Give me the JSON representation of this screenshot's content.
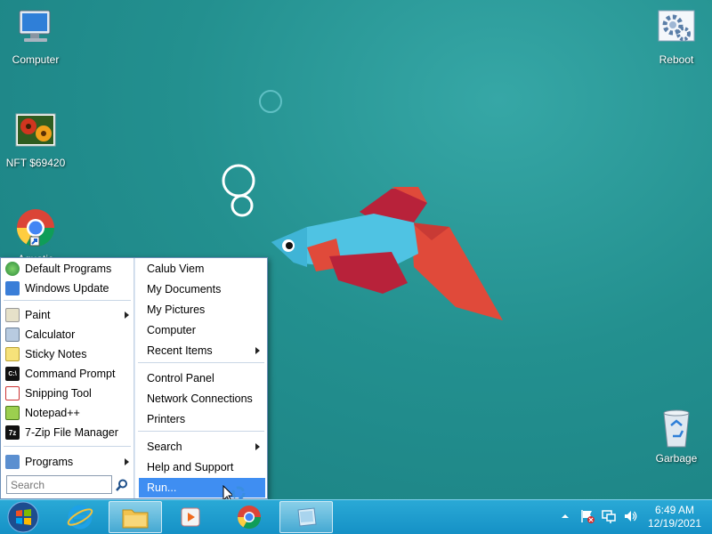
{
  "desktop": {
    "icons": [
      {
        "label": "Computer",
        "icon": "computer-icon"
      },
      {
        "label": "NFT $69420",
        "icon": "flower-image-icon"
      },
      {
        "label": "Aquatic",
        "icon": "chrome-icon"
      },
      {
        "label": "Reboot",
        "icon": "reboot-icon"
      },
      {
        "label": "Garbage",
        "icon": "recycle-bin-icon"
      }
    ]
  },
  "start_menu": {
    "left_items": [
      {
        "label": "Default Programs",
        "icon": "default-programs-icon"
      },
      {
        "label": "Windows Update",
        "icon": "windows-update-icon"
      },
      {
        "label": "Paint",
        "icon": "paint-icon",
        "submenu": true
      },
      {
        "label": "Calculator",
        "icon": "calculator-icon"
      },
      {
        "label": "Sticky Notes",
        "icon": "sticky-notes-icon"
      },
      {
        "label": "Command Prompt",
        "icon": "command-prompt-icon"
      },
      {
        "label": "Snipping Tool",
        "icon": "snipping-tool-icon"
      },
      {
        "label": "Notepad++",
        "icon": "notepad-icon"
      },
      {
        "label": "7-Zip File Manager",
        "icon": "7zip-icon"
      },
      {
        "label": "Programs",
        "icon": "programs-icon",
        "submenu": true
      }
    ],
    "search_placeholder": "Search",
    "right_items": [
      {
        "label": "Calub Viem"
      },
      {
        "label": "My Documents"
      },
      {
        "label": "My Pictures"
      },
      {
        "label": "Computer"
      },
      {
        "label": "Recent Items",
        "submenu": true
      },
      {
        "label": "Control Panel"
      },
      {
        "label": "Network Connections"
      },
      {
        "label": "Printers"
      },
      {
        "label": "Search",
        "submenu": true
      },
      {
        "label": "Help and Support"
      },
      {
        "label": "Run...",
        "highlighted": true
      }
    ]
  },
  "taskbar": {
    "buttons": [
      {
        "name": "start-button",
        "icon": "windows-logo-icon"
      },
      {
        "name": "internet-explorer-button",
        "icon": "internet-explorer-icon"
      },
      {
        "name": "file-explorer-button",
        "icon": "folder-icon",
        "active": true
      },
      {
        "name": "media-player-button",
        "icon": "media-player-icon"
      },
      {
        "name": "chrome-button",
        "icon": "chrome-icon"
      },
      {
        "name": "window-button",
        "icon": "window-icon",
        "active": true
      }
    ],
    "clock": {
      "time": "6:49 AM",
      "date": "12/19/2021"
    }
  },
  "colors": {
    "desktop_bg": "#23908f",
    "taskbar": "#1a9bd0",
    "menu_highlight": "#3f8ef2",
    "fish_blue": "#4fc3e3",
    "fish_red": "#e04a3a",
    "fish_dark_red": "#b8223a"
  }
}
